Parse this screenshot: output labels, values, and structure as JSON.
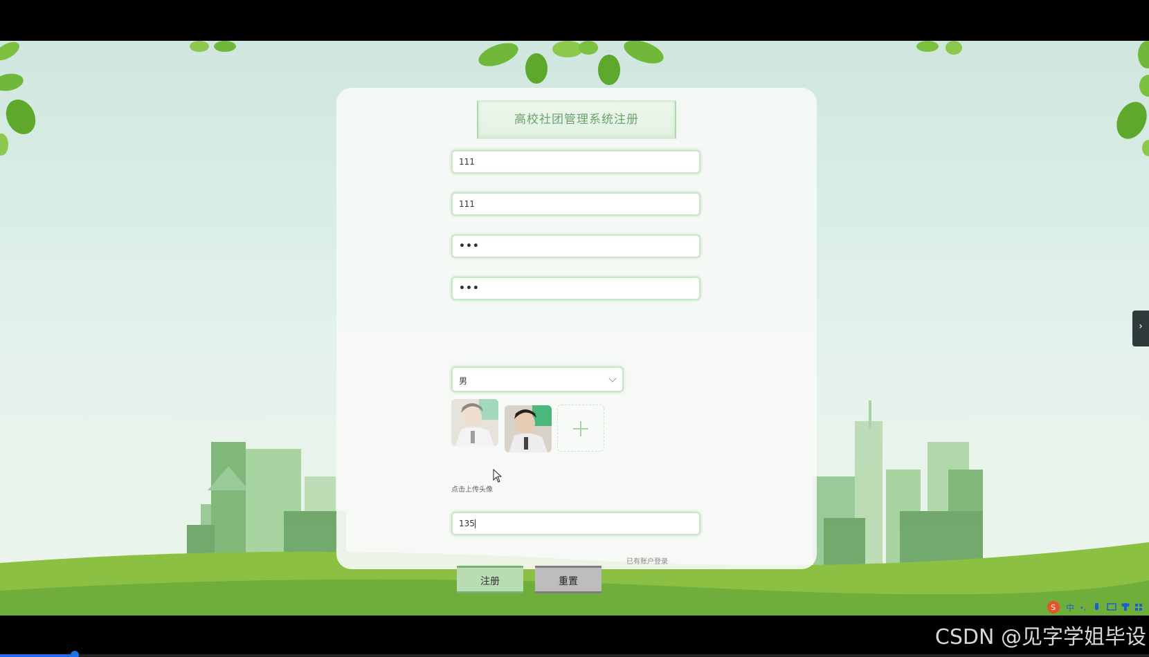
{
  "form": {
    "title": "高校社团管理系统注册",
    "account_value": "111",
    "name_value": "111",
    "password_value": "•••",
    "confirm_password_value": "•••",
    "gender_value": "男",
    "avatar_hint": "点击上传头像",
    "phone_value": "135",
    "login_link": "已有账户登录",
    "register_label": "注册",
    "reset_label": "重置"
  },
  "overlay": {
    "side_toggle": "›",
    "watermark": "CSDN @见字学姐毕设",
    "ime_labels": [
      "S",
      "中",
      "•,",
      "mic",
      "kbd",
      "shirt",
      "grid"
    ]
  },
  "video_progress": 0.065,
  "colors": {
    "accent_green": "#74b36e",
    "title_green": "#6aa36a",
    "progress_blue": "#1a73e8"
  }
}
